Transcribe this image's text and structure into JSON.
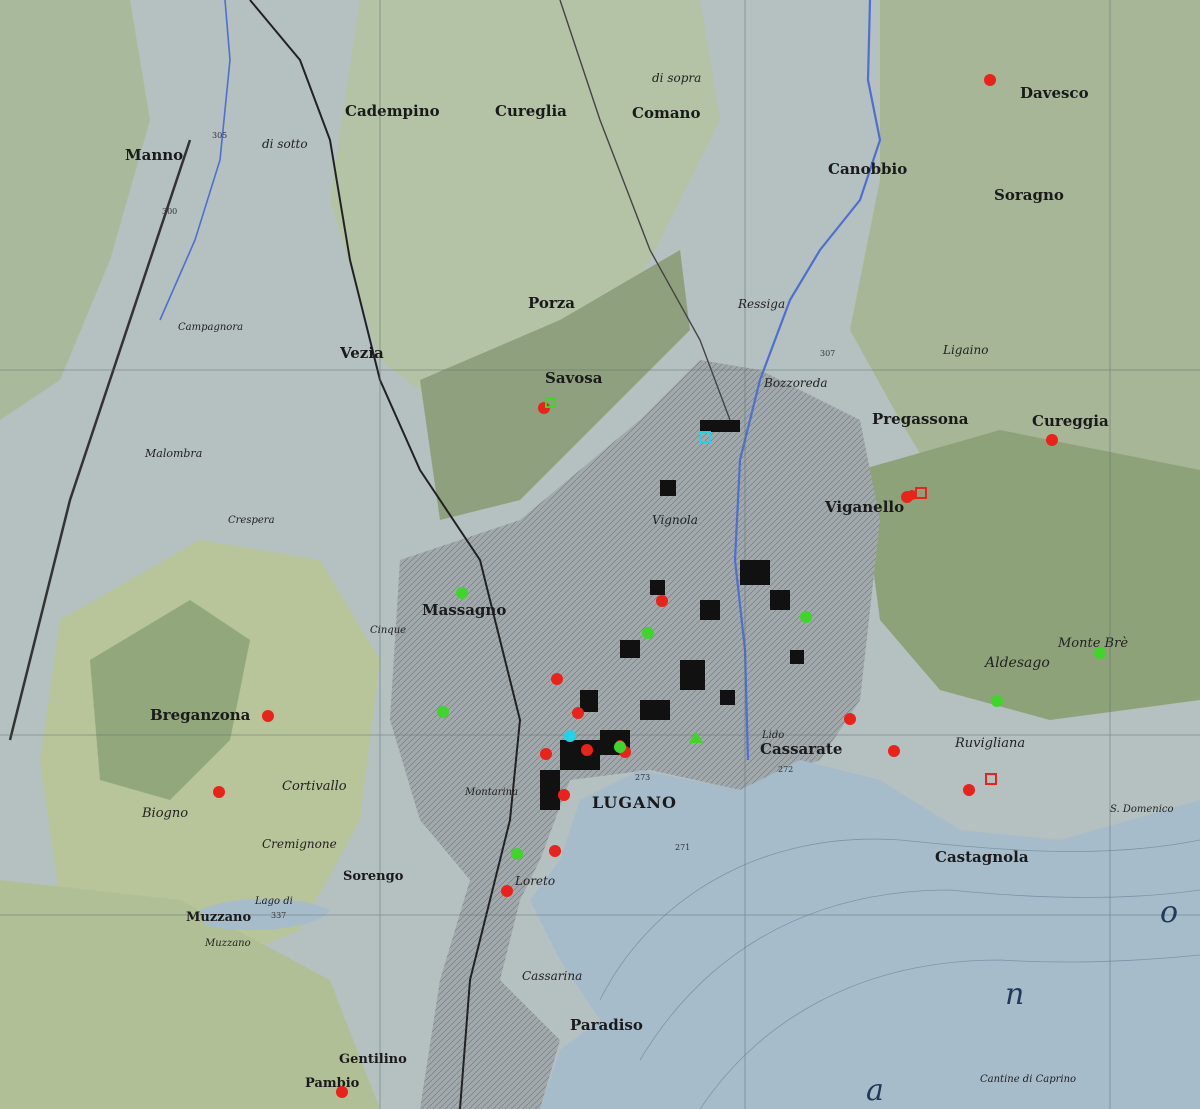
{
  "map": {
    "colors": {
      "lake": "#a7bccb",
      "valley": "#b3bfc2",
      "forest": "#8fa27e",
      "meadow": "#c9cf9c",
      "slope": "#a9b89c",
      "urban": "#9fa7ab",
      "building": "#111111",
      "grid": "#5a6a6a",
      "contour": "#c9a25a",
      "river": "#4f6fd0",
      "marker_red": "#e8231c",
      "marker_green": "#3fd52b",
      "marker_cyan": "#22d3e8"
    },
    "labels": {
      "lugano": "LUGANO",
      "massagno": "Massagno",
      "paradiso": "Paradiso",
      "cassarate": "Cassarate",
      "castagnola": "Castagnola",
      "viganello": "Viganello",
      "breganzona": "Breganzona",
      "porza": "Porza",
      "savosa": "Savosa",
      "vezia": "Vezia",
      "cadempino": "Cadempino",
      "cureglia": "Cureglia",
      "comano": "Comano",
      "canobbio": "Canobbio",
      "davesco": "Davesco",
      "soragno": "Soragno",
      "manno": "Manno",
      "cureggia": "Cureggia",
      "pregassona": "Pregassona",
      "aldesago": "Aldesago",
      "monte_bre": "Monte Brè",
      "ruvigliana": "Ruvigliana",
      "biogno": "Biogno",
      "cortivallo": "Cortivallo",
      "cremignone": "Cremignone",
      "sorengo": "Sorengo",
      "muzzano": "Muzzano",
      "gentilino": "Gentilino",
      "pambio": "Pambio",
      "cassarina": "Cassarina",
      "ligaino": "Ligaino",
      "ressiga": "Ressiga",
      "bozzoreda": "Bozzoreda",
      "vignola": "Vignola",
      "lido": "Lido",
      "loreto": "Loreto",
      "di_sotto": "di sotto",
      "di_sopra": "di sopra",
      "cinque": "Cinque",
      "crespera": "Crespera",
      "malombra": "Malombra",
      "campagnora": "Campagnora",
      "lago_di_muzzano": "Lago di",
      "muzzano_lake": "Muzzano",
      "monteeuro": "Montarina",
      "dom": "S. Domenico",
      "cantine": "Cantine di Caprino",
      "lake_o": "o",
      "lake_n": "n",
      "lake_a": "a",
      "alt_272": "272",
      "alt_271": "271",
      "alt_273": "273",
      "alt_337": "337",
      "alt_300": "300",
      "alt_305": "305",
      "alt_307": "307"
    },
    "markers": [
      {
        "id": "m01",
        "kind": "red-dot"
      },
      {
        "id": "m02",
        "kind": "red-dot"
      },
      {
        "id": "m03",
        "kind": "red-dot"
      },
      {
        "id": "m04",
        "kind": "red-dot"
      },
      {
        "id": "m05",
        "kind": "red-dot"
      },
      {
        "id": "m06",
        "kind": "red-dot"
      },
      {
        "id": "m07",
        "kind": "red-dot"
      },
      {
        "id": "m08",
        "kind": "red-dot"
      },
      {
        "id": "m09",
        "kind": "red-dot"
      },
      {
        "id": "m10",
        "kind": "red-dot"
      },
      {
        "id": "m11",
        "kind": "red-dot"
      },
      {
        "id": "m12",
        "kind": "red-dot"
      },
      {
        "id": "m13",
        "kind": "red-dot"
      },
      {
        "id": "m14",
        "kind": "red-dot"
      },
      {
        "id": "m15",
        "kind": "red-dot"
      },
      {
        "id": "m16",
        "kind": "red-dot"
      },
      {
        "id": "m17",
        "kind": "red-dot"
      },
      {
        "id": "m18",
        "kind": "red-dot"
      },
      {
        "id": "m19",
        "kind": "red-dot"
      },
      {
        "id": "m20",
        "kind": "red-dot"
      },
      {
        "id": "m21",
        "kind": "red-dot"
      },
      {
        "id": "m22",
        "kind": "green-dot"
      },
      {
        "id": "m23",
        "kind": "green-dot"
      },
      {
        "id": "m24",
        "kind": "green-dot"
      },
      {
        "id": "m25",
        "kind": "green-dot"
      },
      {
        "id": "m26",
        "kind": "green-dot"
      },
      {
        "id": "m27",
        "kind": "green-dot"
      },
      {
        "id": "m28",
        "kind": "green-dot"
      },
      {
        "id": "m29",
        "kind": "green-dot"
      },
      {
        "id": "m30",
        "kind": "green-triangle"
      },
      {
        "id": "m31",
        "kind": "cyan-dot"
      },
      {
        "id": "m32",
        "kind": "cyan-square"
      },
      {
        "id": "m33",
        "kind": "red-square"
      },
      {
        "id": "m34",
        "kind": "red-square"
      },
      {
        "id": "m35",
        "kind": "green-square"
      }
    ]
  }
}
